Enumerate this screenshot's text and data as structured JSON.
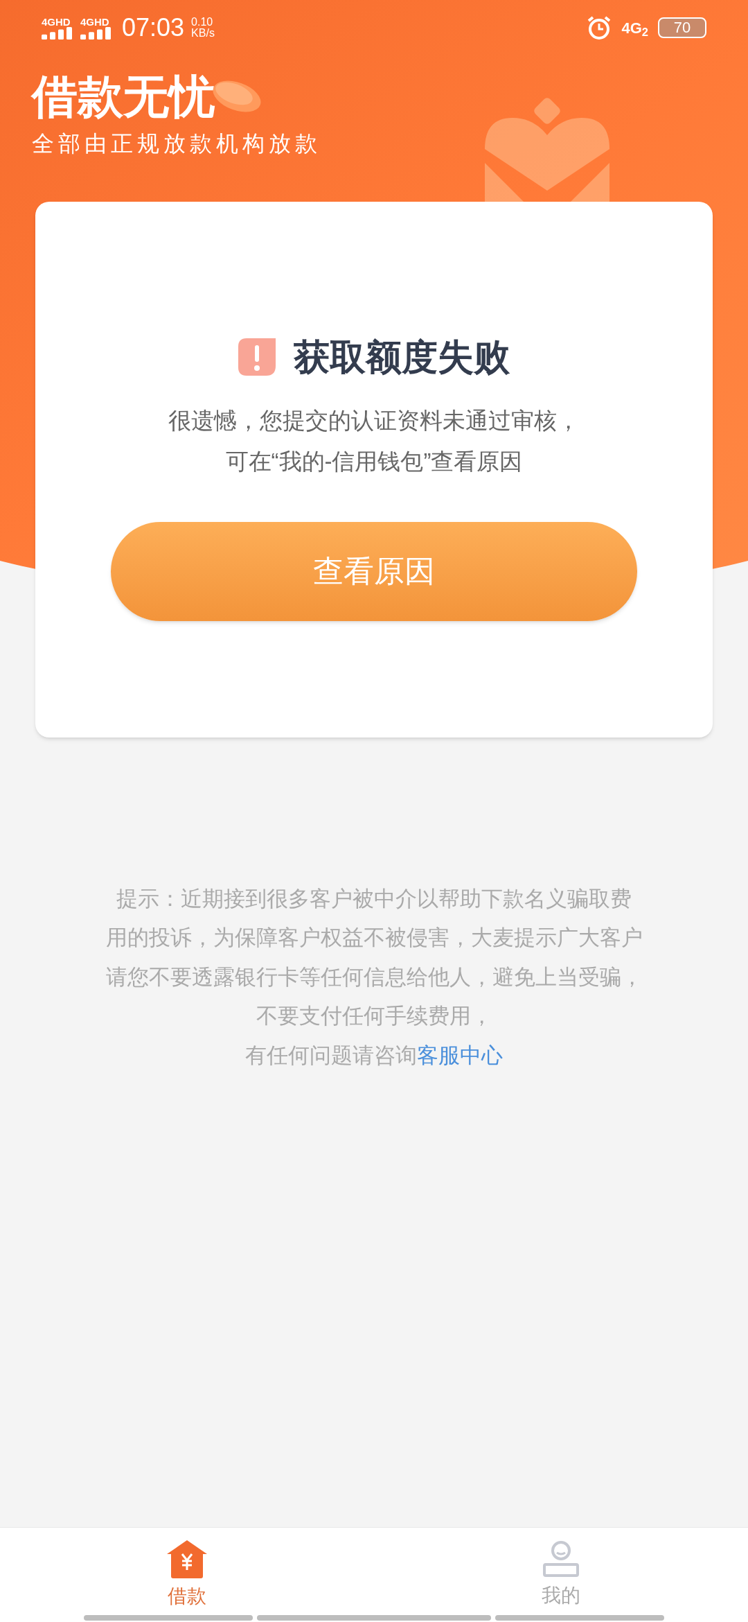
{
  "status_bar": {
    "sim_labels": [
      "4GHD",
      "4GHD"
    ],
    "time": "07:03",
    "speed_value": "0.10",
    "speed_unit": "KB/s",
    "network": "4G$_{2}$",
    "battery": "70"
  },
  "header": {
    "title": "借款无忧",
    "subtitle": "全部由正规放款机构放款"
  },
  "card": {
    "title": "获取额度失败",
    "message_lines": [
      "很遗憾，您提交的认证资料未通过审核，",
      "可在“我的-信用钱包”查看原因"
    ],
    "button": "查看原因"
  },
  "notice": {
    "lines": [
      "提示：近期接到很多客户被中介以帮助下款名义骗取费",
      "用的投诉，为保障客户权益不被侵害，大麦提示广大客户",
      "请您不要透露银行卡等任何信息给他人，避免上当受骗，",
      "不要支付任何手续费用，"
    ],
    "last_line": "有任何问题请咨询",
    "link": "客服中心"
  },
  "tabs": [
    {
      "label": "借款",
      "kind": "loan",
      "selected": true
    },
    {
      "label": "我的",
      "kind": "profile",
      "selected": false
    }
  ]
}
